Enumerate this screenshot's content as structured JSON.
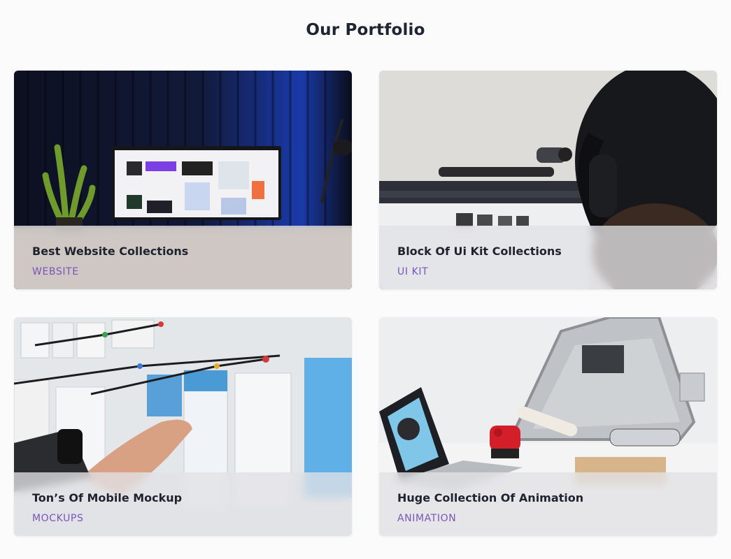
{
  "section": {
    "title": "Our Portfolio"
  },
  "cards": [
    {
      "title": "Best Website Collections",
      "tag": "WEBSITE"
    },
    {
      "title": "Block Of Ui Kit Collections",
      "tag": "UI KIT"
    },
    {
      "title": "Ton’s Of Mobile Mockup",
      "tag": "MOCKUPS"
    },
    {
      "title": "Huge Collection Of Animation",
      "tag": "ANIMATION"
    }
  ],
  "colors": {
    "heading": "#1e2432",
    "tag": "#7b54b8",
    "overlay": "#e1e2e6"
  }
}
